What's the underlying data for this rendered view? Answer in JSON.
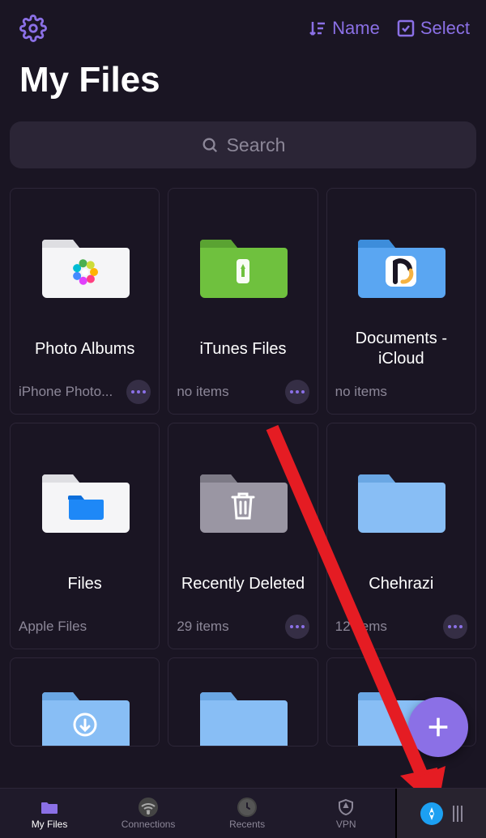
{
  "colors": {
    "accent": "#8b70e6",
    "bg": "#1a1523"
  },
  "header": {
    "sort_label": "Name",
    "select_label": "Select"
  },
  "title": "My Files",
  "search": {
    "placeholder": "Search"
  },
  "folders": [
    {
      "name": "Photo Albums",
      "subtitle": "iPhone Photo...",
      "show_more": true
    },
    {
      "name": "iTunes Files",
      "subtitle": "no items",
      "show_more": true
    },
    {
      "name": "Documents - iCloud",
      "subtitle": "no items",
      "show_more": false
    },
    {
      "name": "Files",
      "subtitle": "Apple Files",
      "show_more": false
    },
    {
      "name": "Recently Deleted",
      "subtitle": "29 items",
      "show_more": true
    },
    {
      "name": "Chehrazi",
      "subtitle": "12 items",
      "show_more": true
    }
  ],
  "tabs": [
    {
      "label": "My Files"
    },
    {
      "label": "Connections"
    },
    {
      "label": "Recents"
    },
    {
      "label": "VPN"
    }
  ]
}
